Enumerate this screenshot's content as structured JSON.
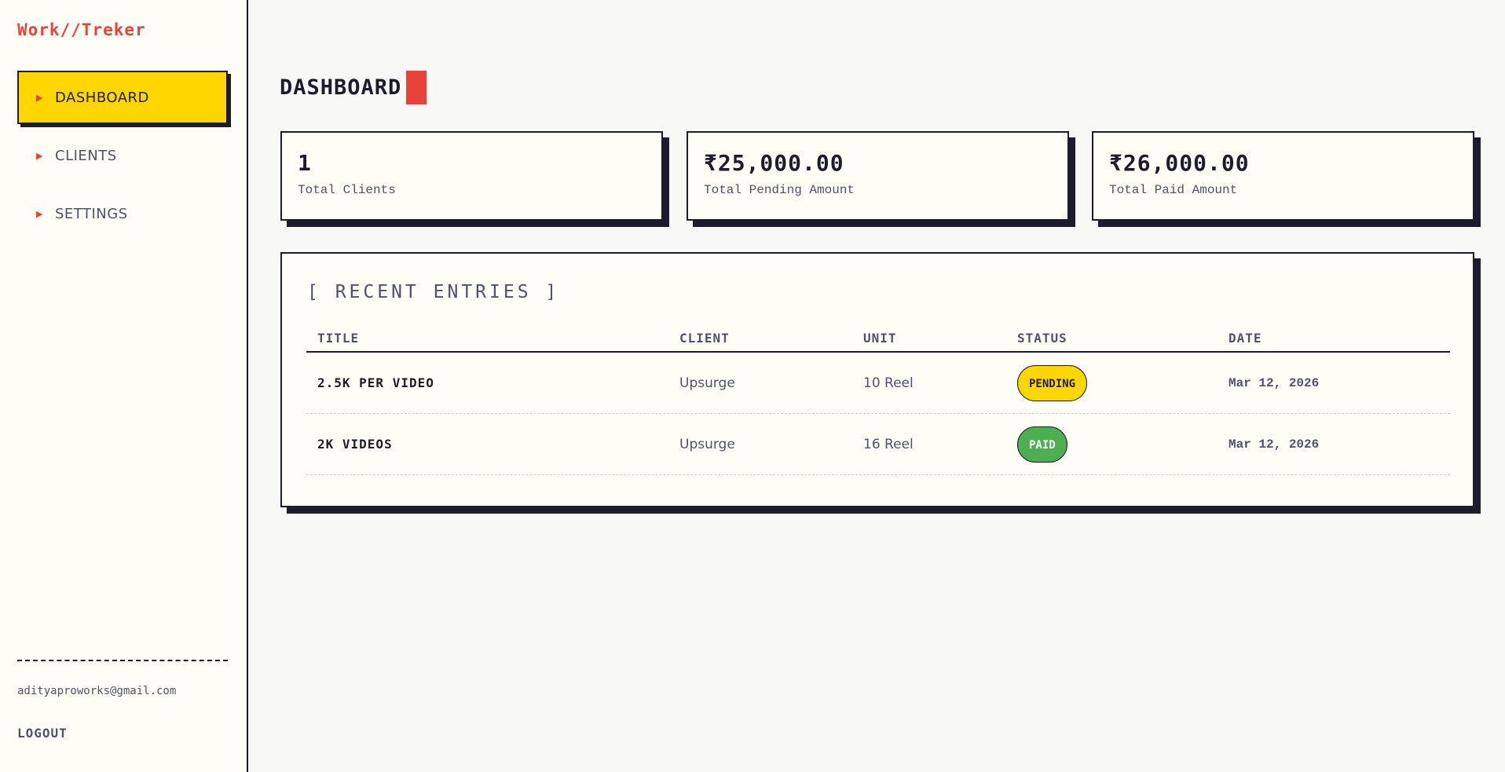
{
  "brand": {
    "name": "Work//Treker"
  },
  "colors": {
    "accent_red": "#e8433a",
    "accent_yellow": "#ffd600",
    "paid_green": "#4caf50",
    "ink": "#1c1c2e",
    "muted": "#4e5272"
  },
  "sidebar": {
    "items": [
      {
        "label": "DASHBOARD",
        "icon": "triangle-right-icon",
        "active": true
      },
      {
        "label": "CLIENTS",
        "icon": "triangle-right-icon",
        "active": false
      },
      {
        "label": "SETTINGS",
        "icon": "triangle-right-icon",
        "active": false
      }
    ],
    "user_email": "adityaproworks@gmail.com",
    "logout_label": "LOGOUT"
  },
  "main": {
    "title": "DASHBOARD",
    "stats": [
      {
        "value": "1",
        "label": "Total Clients"
      },
      {
        "value": "₹25,000.00",
        "label": "Total Pending Amount"
      },
      {
        "value": "₹26,000.00",
        "label": "Total Paid Amount"
      }
    ],
    "recent_entries": {
      "heading": "[ RECENT ENTRIES ]",
      "columns": [
        "TITLE",
        "CLIENT",
        "UNIT",
        "STATUS",
        "DATE"
      ],
      "rows": [
        {
          "title": "2.5K PER VIDEO",
          "client": "Upsurge",
          "unit": "10 Reel",
          "status": "PENDING",
          "date": "Mar 12, 2026"
        },
        {
          "title": "2K VIDEOS",
          "client": "Upsurge",
          "unit": "16 Reel",
          "status": "PAID",
          "date": "Mar 12, 2026"
        }
      ]
    }
  }
}
